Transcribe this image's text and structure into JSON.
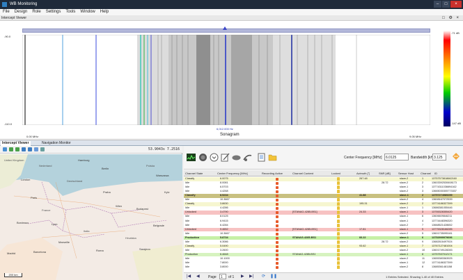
{
  "window": {
    "title": "WB Monitoring"
  },
  "menu": [
    "File",
    "Design",
    "Role",
    "Settings",
    "Tools",
    "Window",
    "Help"
  ],
  "view": {
    "label": "Intercept Viewer",
    "controls": "□ ⚙ ×"
  },
  "spectrum": {
    "y_top": "-90.0",
    "y_bottom": "-110.0",
    "freq_left": "0.00 MHz",
    "freq_right": "9.05 MHz",
    "center": "6,012.000 Hz",
    "label": "Sonagram",
    "colorbar_top": "-71 dB",
    "colorbar_bottom": "-147 dB"
  },
  "tabs": [
    "Intercept Viewer",
    "Navigation Monitor"
  ],
  "map": {
    "coords": "53.9043s  7.2516",
    "scale": "200 km",
    "labels": [
      {
        "text": "United Kingdom",
        "city": false
      },
      {
        "text": "Nederland",
        "city": false
      },
      {
        "text": "Berlin",
        "city": true
      },
      {
        "text": "Hamburg",
        "city": true
      },
      {
        "text": "Polska",
        "city": false
      },
      {
        "text": "Warszawa",
        "city": true
      },
      {
        "text": "London",
        "city": true
      },
      {
        "text": "Deutschland",
        "city": false
      },
      {
        "text": "Praha",
        "city": true
      },
      {
        "text": "Paris",
        "city": true
      },
      {
        "text": "France",
        "city": false
      },
      {
        "text": "Wien",
        "city": true
      },
      {
        "text": "Bordeaux",
        "city": true
      },
      {
        "text": "Italia",
        "city": false
      },
      {
        "text": "Roma",
        "city": true
      },
      {
        "text": "Budapest",
        "city": true
      },
      {
        "text": "Belgrade",
        "city": true
      },
      {
        "text": "Madrid",
        "city": true
      },
      {
        "text": "Hrvatska",
        "city": false
      },
      {
        "text": "Sarajevo",
        "city": true
      },
      {
        "text": "Lyon",
        "city": true
      },
      {
        "text": "Marseille",
        "city": true
      },
      {
        "text": "Barcelona",
        "city": true
      },
      {
        "text": "Kyiv",
        "city": true
      }
    ]
  },
  "toolbar": {
    "center_freq_label": "Center Frequency [MHz]",
    "center_freq_value": "6.0125",
    "bandwidth_label": "Bandwidth [kHz]",
    "bandwidth_value": "3.125"
  },
  "grid": {
    "headers": [
      "Channel State",
      "Center Frequency [MHz]",
      "Recording Active",
      "Channel Content",
      "Locked",
      "Azimuth [°]",
      "SNR [dB]",
      "Sensor Host",
      "Channel",
      "ID"
    ],
    "rows": [
      {
        "state": "Classify",
        "freq": "6.0075",
        "content": "",
        "azimuth": "267.48",
        "snr": "",
        "host": "slave-2",
        "channel": "1",
        "id": "13757573818662160",
        "bg": "#f6f6d0",
        "bold": false
      },
      {
        "state": "Idle",
        "freq": "8.0081",
        "content": "",
        "azimuth": "",
        "snr": "28.72",
        "host": "slave-2",
        "channel": "2",
        "id": "13603392530608173",
        "bg": "#ffffff",
        "bold": false
      },
      {
        "state": "Idle",
        "freq": "6.5703",
        "content": "",
        "azimuth": "",
        "snr": "",
        "host": "slave-1",
        "channel": "3",
        "id": "13774311036694162",
        "bg": "#ffffff",
        "bold": false
      },
      {
        "state": "Idle",
        "freq": "4.4268",
        "content": "",
        "azimuth": "",
        "snr": "",
        "host": "slave-2",
        "channel": "3",
        "id": "13665030305773337",
        "bg": "#ffffff",
        "bold": false
      },
      {
        "state": "Classify",
        "freq": "8.5234",
        "content": "",
        "azimuth": "41.88",
        "snr": "",
        "host": "slave-1",
        "channel": "2",
        "id": "13757274989259",
        "bg": "#c8c080",
        "bold": true
      },
      {
        "state": "Idle",
        "freq": "10.3667",
        "content": "",
        "azimuth": "",
        "snr": "",
        "host": "slave-2",
        "channel": "4",
        "id": "13608167072539",
        "bg": "#ffffff",
        "bold": false
      },
      {
        "state": "Classify",
        "freq": "3.8630",
        "content": "",
        "azimuth": "195.31",
        "snr": "",
        "host": "slave-2",
        "channel": "2",
        "id": "13774186327399",
        "bg": "#f6f6d0",
        "bold": false
      },
      {
        "state": "Idle",
        "freq": "4.4286",
        "content": "",
        "azimuth": "",
        "snr": "",
        "host": "slave-1",
        "channel": "1",
        "id": "13686381055446",
        "bg": "#ffffff",
        "bold": false
      },
      {
        "state": "Unlocked",
        "freq": "3.4790",
        "content": "[STANAG-4285-BS1]",
        "azimuth": "24.33",
        "snr": "",
        "host": "slave-1",
        "channel": "3",
        "id": "13755328355420",
        "bg": "#f7c2c2",
        "bold": false
      },
      {
        "state": "Idle",
        "freq": "8.0125",
        "content": "",
        "azimuth": "",
        "snr": "",
        "host": "slave-1",
        "channel": "6",
        "id": "13606609846211",
        "bg": "#ffffff",
        "bold": false
      },
      {
        "state": "Idle",
        "freq": "6.9415",
        "content": "",
        "azimuth": "",
        "snr": "",
        "host": "slave-1",
        "channel": "4",
        "id": "13774448396320",
        "bg": "#ffffff",
        "bold": false
      },
      {
        "state": "Idle",
        "freq": "6.4284",
        "content": "",
        "azimuth": "",
        "snr": "",
        "host": "slave-2",
        "channel": "7",
        "id": "13668521428652",
        "bg": "#ffffff",
        "bold": false
      },
      {
        "state": "Unlocked",
        "freq": "9.4652",
        "content": "[STANAG-4285-BS1]",
        "azimuth": "17.81",
        "snr": "",
        "host": "slave-1",
        "channel": "5",
        "id": "13775328166285",
        "bg": "#f7c2c2",
        "bold": false
      },
      {
        "state": "Idle",
        "freq": "10.3667",
        "content": "",
        "azimuth": "",
        "snr": "",
        "host": "slave-2",
        "channel": "5",
        "id": "13601735095181",
        "bg": "#ffffff",
        "bold": false
      },
      {
        "state": "Production",
        "freq": "5.8734",
        "content": "STANAG-4285-BS1",
        "azimuth": "66.22",
        "snr": "",
        "host": "slave-1",
        "channel": "6",
        "id": "13752999979696",
        "bg": "#c6f0a6",
        "bold": true
      },
      {
        "state": "Idle",
        "freq": "6.3086",
        "content": "",
        "azimuth": "",
        "snr": "28.72",
        "host": "slave-2",
        "channel": "9",
        "id": "13682616497924",
        "bg": "#ffffff",
        "bold": false
      },
      {
        "state": "Classify",
        "freq": "5.0490",
        "content": "",
        "azimuth": "93.62",
        "snr": "",
        "host": "slave-1",
        "channel": "7",
        "id": "13767127481004",
        "bg": "#f6f6d0",
        "bold": false
      },
      {
        "state": "Idle",
        "freq": "3.2600",
        "content": "",
        "azimuth": "",
        "snr": "",
        "host": "slave-2",
        "channel": "10",
        "id": "13601749128283",
        "bg": "#ffffff",
        "bold": false
      },
      {
        "state": "Production",
        "freq": "6.4648",
        "content": "STANAG-4285-BS1",
        "azimuth": "",
        "snr": "",
        "host": "slave-1",
        "channel": "8",
        "id": "13757537012171",
        "bg": "#d6f3bf",
        "bold": false
      },
      {
        "state": "Idle",
        "freq": "10.1000",
        "content": "",
        "azimuth": "",
        "snr": "",
        "host": "slave-2",
        "channel": "11",
        "id": "13655383363925",
        "bg": "#ffffff",
        "bold": false
      },
      {
        "state": "Idle",
        "freq": "7.8000",
        "content": "",
        "azimuth": "",
        "snr": "",
        "host": "slave-1",
        "channel": "12",
        "id": "13774186327399",
        "bg": "#ffffff",
        "bold": false
      },
      {
        "state": "Idle",
        "freq": "3.8000",
        "content": "",
        "azimuth": "",
        "snr": "",
        "host": "slave-2",
        "channel": "8",
        "id": "13685361481158",
        "bg": "#ffffff",
        "bold": false
      }
    ]
  },
  "footer": {
    "page_label": "Page",
    "page_value": "1",
    "page_of": "of 1",
    "status": "1 Entries Selected. Showing 1-40 of 40 Entries"
  }
}
